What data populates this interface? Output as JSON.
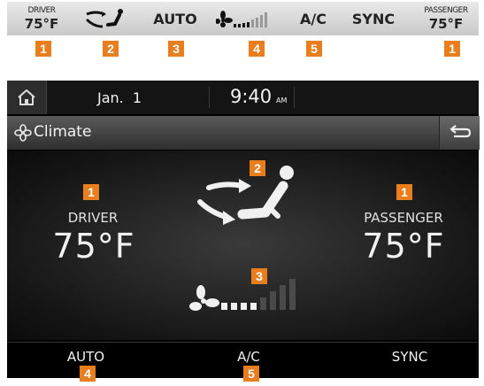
{
  "strip": {
    "driver_label": "DRIVER",
    "driver_temp": "75°F",
    "auto": "AUTO",
    "ac": "A/C",
    "sync": "SYNC",
    "passenger_label": "PASSENGER",
    "passenger_temp": "75°F",
    "badges": [
      "1",
      "2",
      "3",
      "4",
      "5",
      "1"
    ]
  },
  "status": {
    "date": "Jan.  1",
    "time": "9:40",
    "ampm": "AM"
  },
  "title": {
    "text": "Climate"
  },
  "main": {
    "driver_label": "DRIVER",
    "driver_temp": "75°F",
    "passenger_label": "PASSENGER",
    "passenger_temp": "75°F",
    "badges": [
      "1",
      "2",
      "3",
      "1"
    ],
    "fan_level": 0.5
  },
  "bottom": {
    "auto": "AUTO",
    "ac": "A/C",
    "sync": "SYNC",
    "badges": [
      "4",
      "5"
    ]
  },
  "colors": {
    "badge": "#e97e1e",
    "screen_bg": "#000000",
    "text": "#f2f2f2"
  },
  "icons": [
    "home-icon",
    "fan-icon",
    "back-icon",
    "airflow-icon",
    "seat-icon"
  ]
}
